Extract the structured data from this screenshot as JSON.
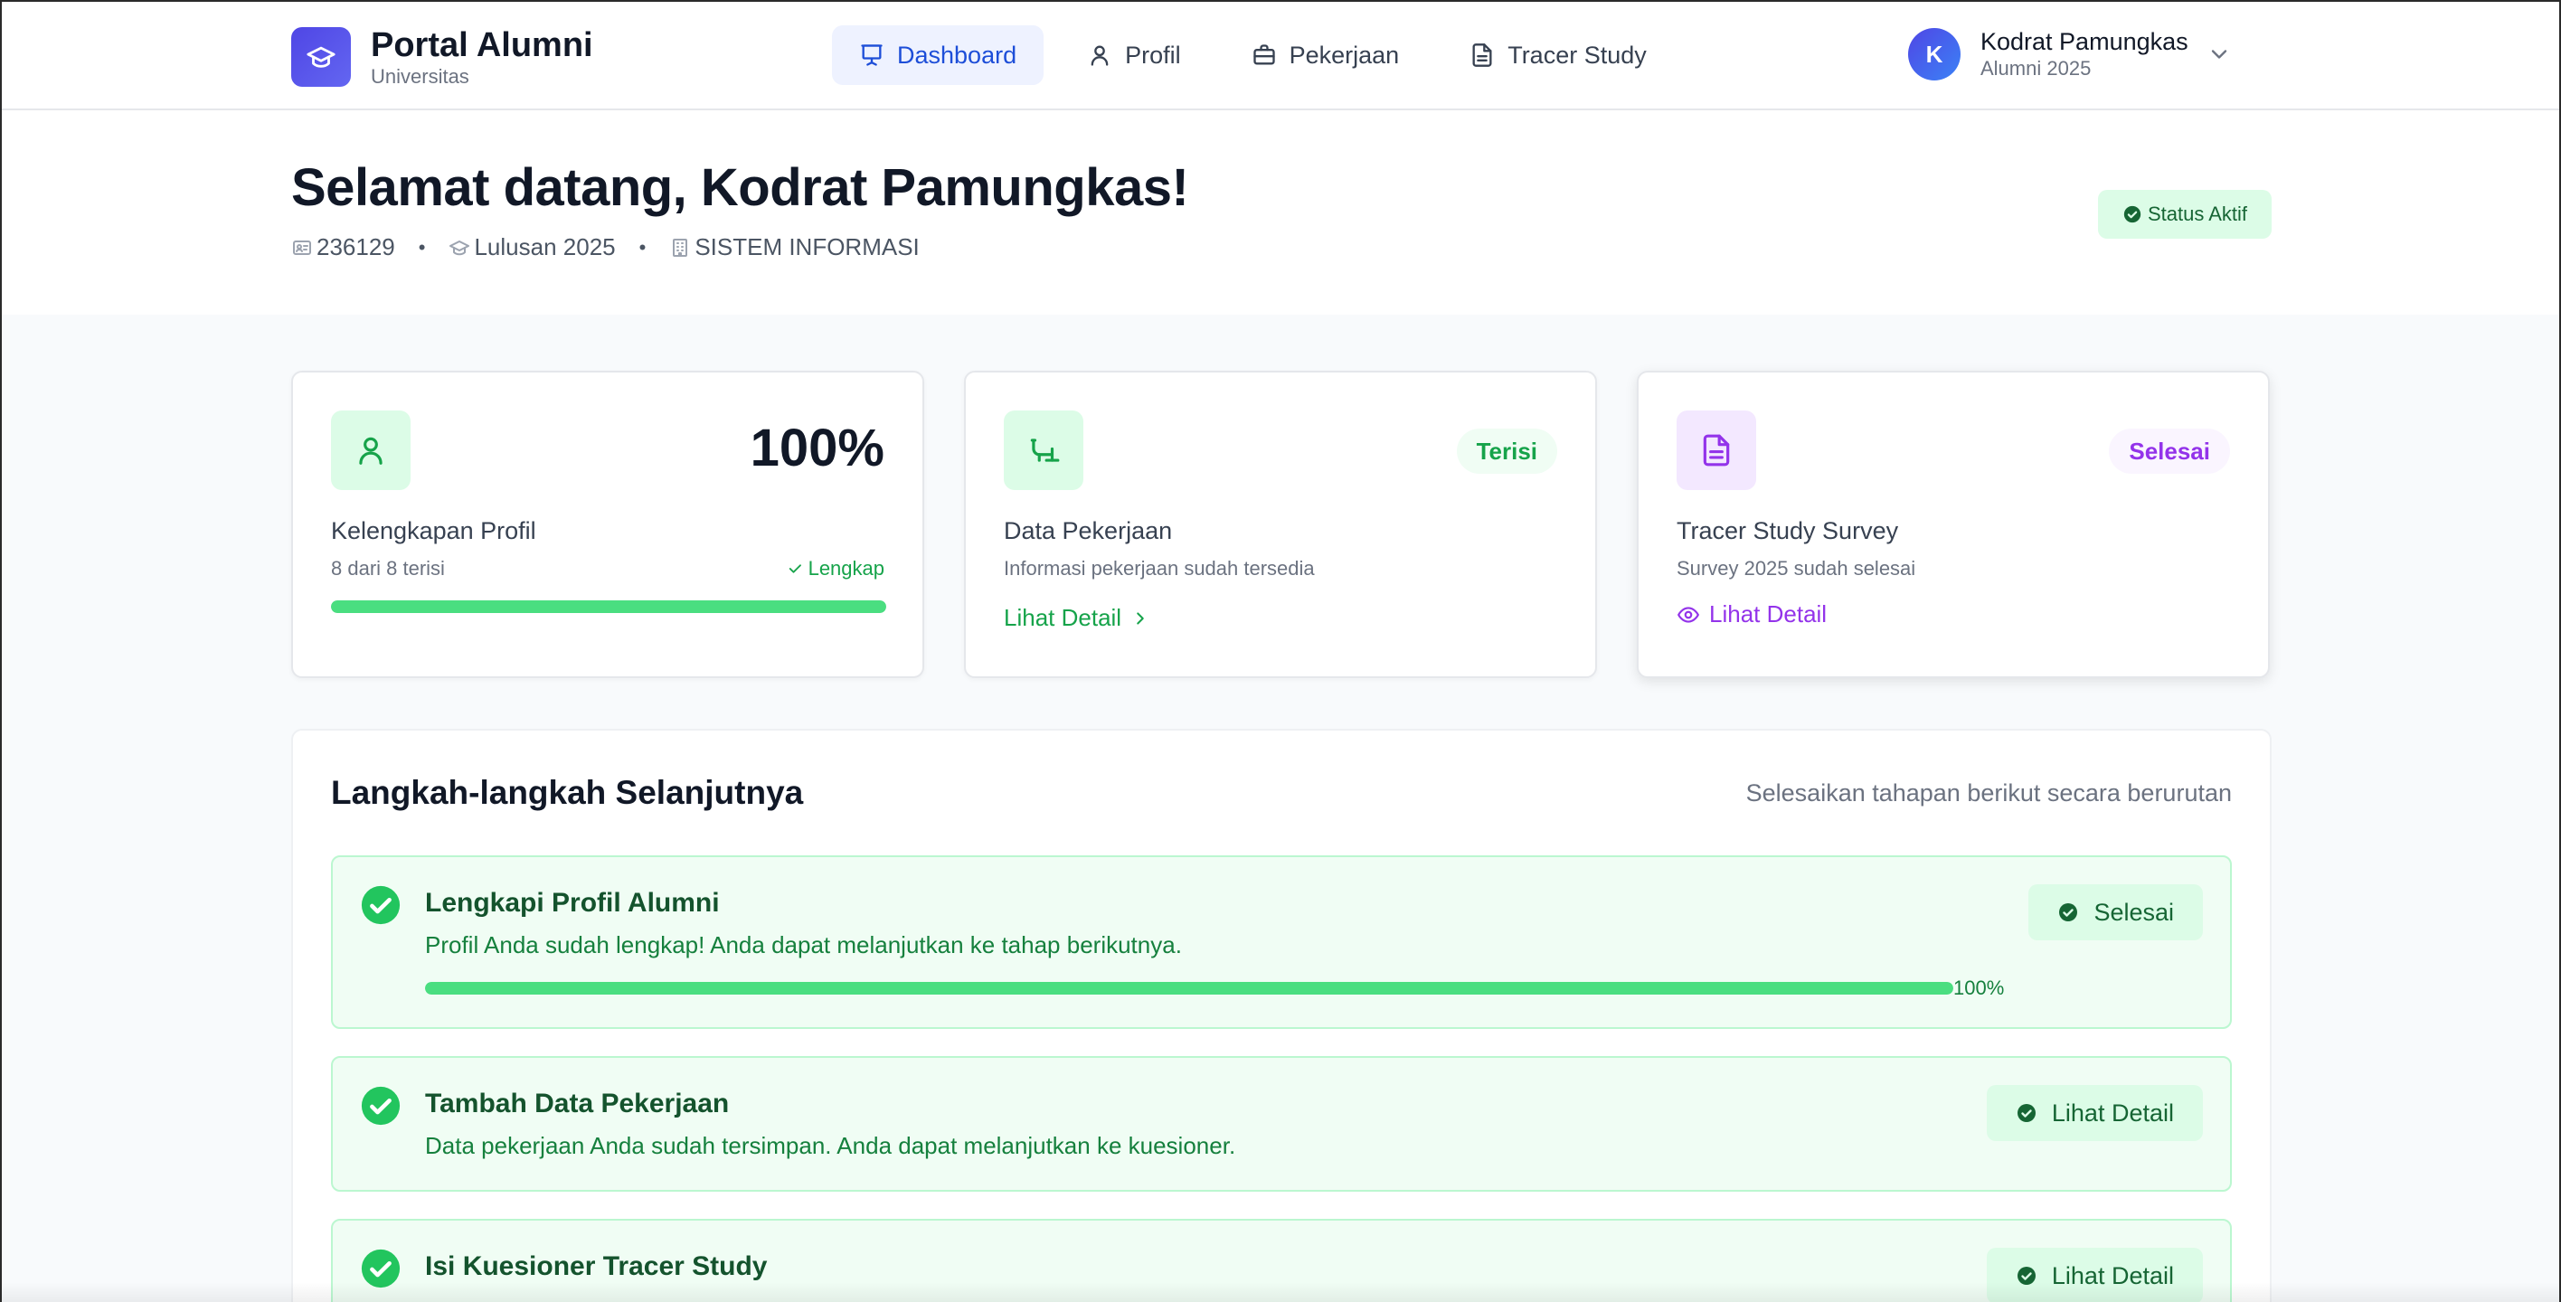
{
  "colors": {
    "accent": "#4f46e5",
    "nav_active_bg": "#eef2ff",
    "nav_active_text": "#1d4ed8",
    "success": "#16a34a",
    "success_bg": "#dcfce7",
    "purple": "#9333ea",
    "purple_bg": "#f3e8ff"
  },
  "brand": {
    "title": "Portal Alumni",
    "subtitle": "Universitas",
    "icon": "graduation-cap-icon"
  },
  "nav": [
    {
      "label": "Dashboard",
      "icon": "presentation-icon",
      "active": true
    },
    {
      "label": "Profil",
      "icon": "user-icon",
      "active": false
    },
    {
      "label": "Pekerjaan",
      "icon": "briefcase-icon",
      "active": false
    },
    {
      "label": "Tracer Study",
      "icon": "file-text-icon",
      "active": false
    }
  ],
  "user": {
    "initial": "K",
    "name": "Kodrat Pamungkas",
    "role": "Alumni 2025"
  },
  "hero": {
    "title": "Selamat datang, Kodrat Pamungkas!",
    "nim": "236129",
    "angkatan": "Lulusan 2025",
    "prodi": "SISTEM INFORMASI",
    "separator": "•",
    "status": "Status Aktif"
  },
  "cards": {
    "profil": {
      "value": "100%",
      "title": "Kelengkapan Profil",
      "subtitle": "8 dari 8 terisi",
      "status": "Lengkap",
      "progress": 100
    },
    "pekerjaan": {
      "badge": "Terisi",
      "title": "Data Pekerjaan",
      "subtitle": "Informasi pekerjaan sudah tersedia",
      "link": "Lihat Detail"
    },
    "tracer": {
      "badge": "Selesai",
      "title": "Tracer Study Survey",
      "subtitle": "Survey 2025 sudah selesai",
      "link": "Lihat Detail"
    }
  },
  "steps": {
    "title": "Langkah-langkah Selanjutnya",
    "hint": "Selesaikan tahapan berikut secara berurutan",
    "items": [
      {
        "title": "Lengkapi Profil Alumni",
        "desc": "Profil Anda sudah lengkap! Anda dapat melanjutkan ke tahap berikutnya.",
        "progress": 100,
        "progress_label": "100%",
        "button": "Selesai"
      },
      {
        "title": "Tambah Data Pekerjaan",
        "desc": "Data pekerjaan Anda sudah tersimpan. Anda dapat melanjutkan ke kuesioner.",
        "button": "Lihat Detail"
      },
      {
        "title": "Isi Kuesioner Tracer Study",
        "button": "Lihat Detail"
      }
    ]
  }
}
